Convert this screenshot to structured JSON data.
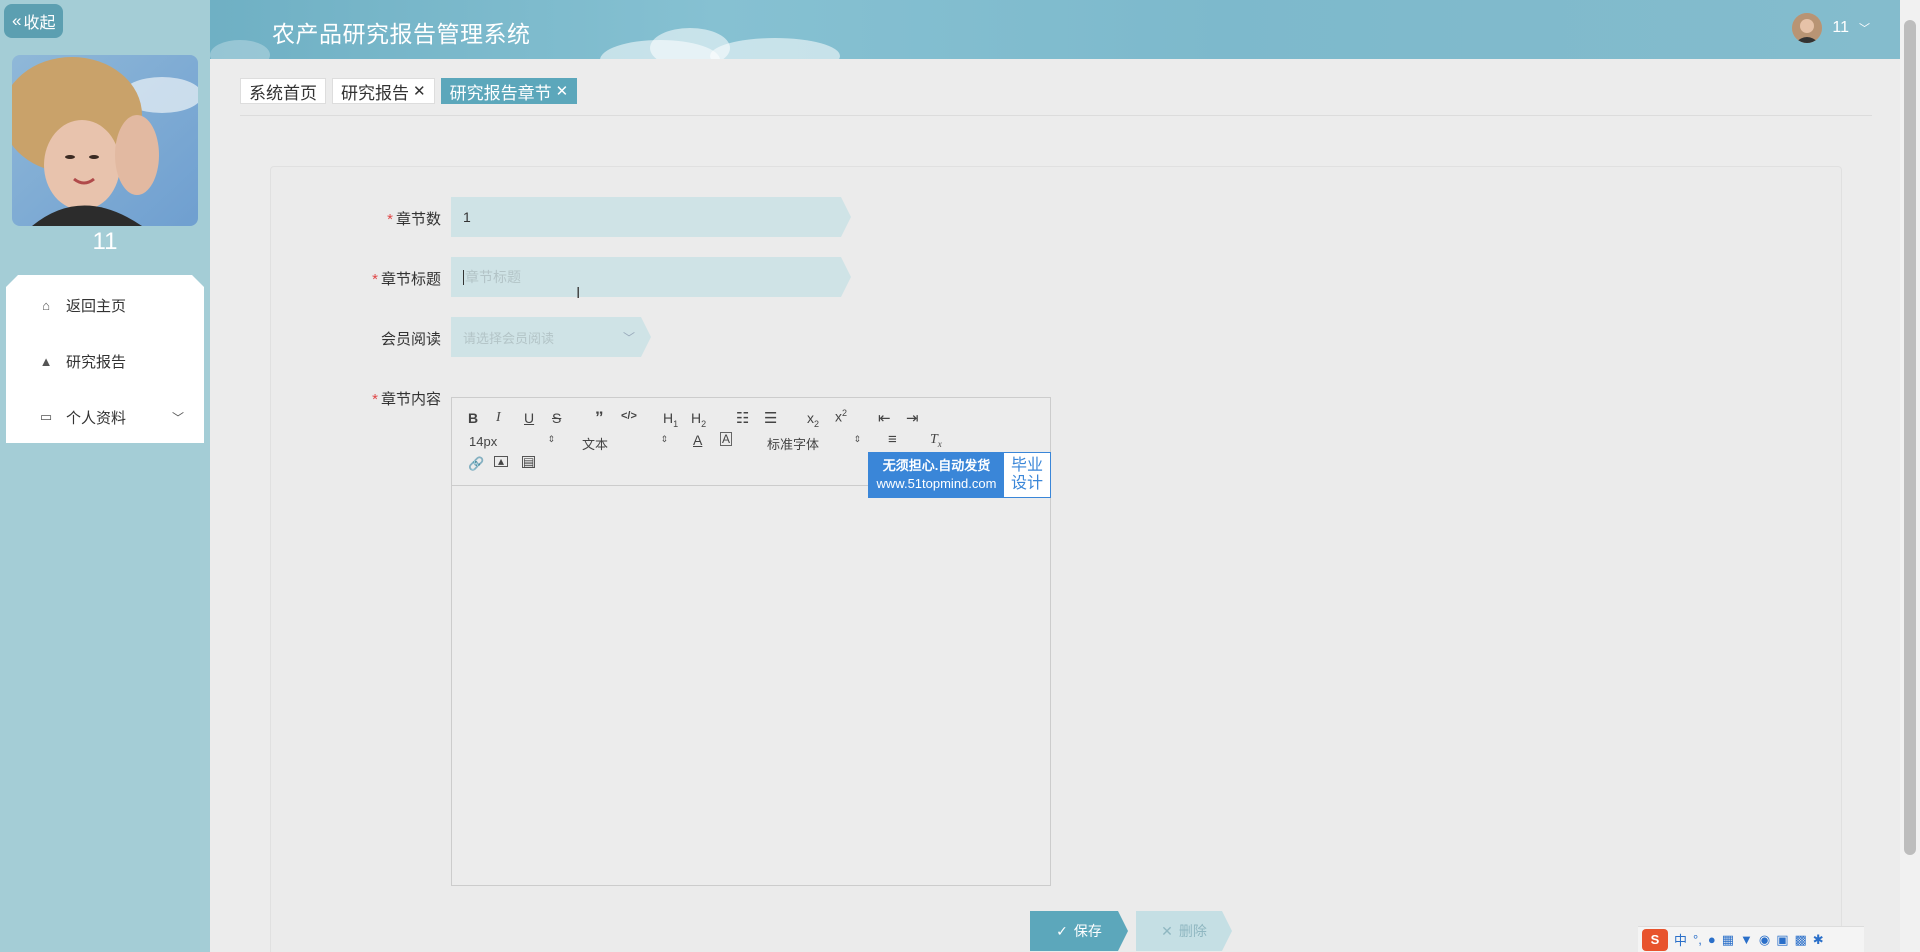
{
  "sidebar": {
    "collapse_label": "收起",
    "username": "11",
    "menu": [
      {
        "label": "返回主页",
        "icon": "home-icon"
      },
      {
        "label": "研究报告",
        "icon": "user-icon"
      },
      {
        "label": "个人资料",
        "icon": "wallet-icon"
      }
    ]
  },
  "header": {
    "title": "农产品研究报告管理系统",
    "user": "11"
  },
  "tabs": [
    {
      "label": "系统首页",
      "closable": false,
      "active": false
    },
    {
      "label": "研究报告",
      "closable": true,
      "active": false
    },
    {
      "label": "研究报告章节",
      "closable": true,
      "active": true
    }
  ],
  "form": {
    "chapter_number": {
      "label": "章节数",
      "value": "1",
      "required": true
    },
    "chapter_title": {
      "label": "章节标题",
      "placeholder": "章节标题",
      "required": true
    },
    "member_read": {
      "label": "会员阅读",
      "placeholder": "请选择会员阅读"
    },
    "chapter_content": {
      "label": "章节内容",
      "required": true
    }
  },
  "editor": {
    "font_size": "14px",
    "block_type": "文本",
    "font_family": "标准字体"
  },
  "promo": {
    "line1": "无须担心.自动发货",
    "line2": "www.51topmind.com",
    "right1": "毕业",
    "right2": "设计"
  },
  "buttons": {
    "save": "保存",
    "delete": "删除"
  },
  "ime": {
    "logo": "S",
    "mode": "中"
  },
  "colors": {
    "accent": "#5ca7bb",
    "sidebar": "#a4cdd6",
    "input_bg": "#cfe3e6",
    "required": "#e04646"
  }
}
